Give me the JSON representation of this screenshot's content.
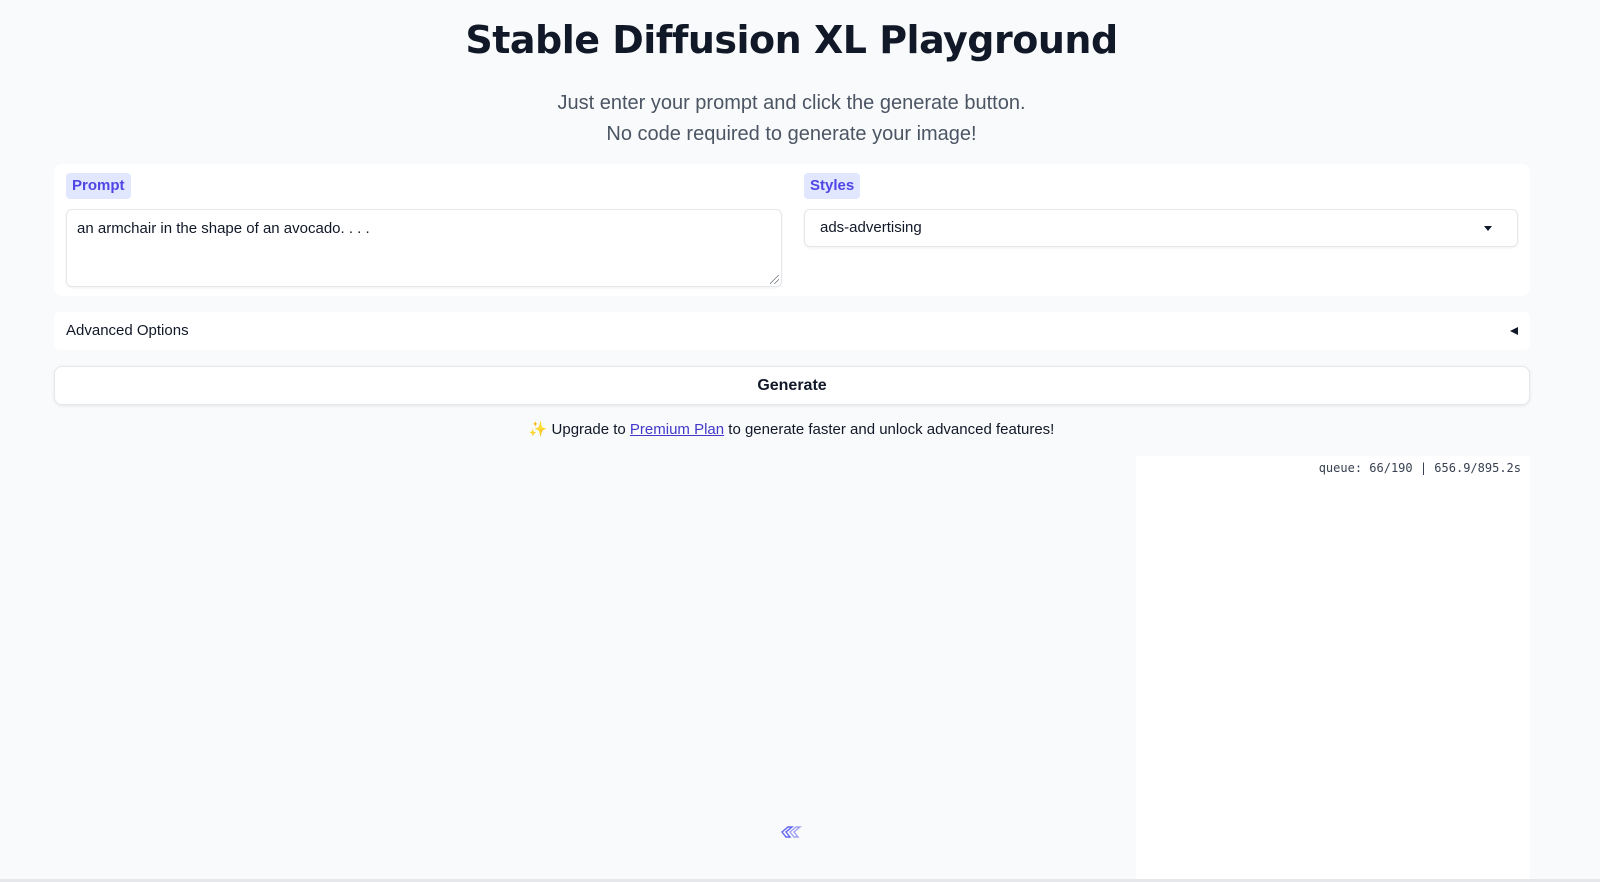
{
  "header": {
    "title": "Stable Diffusion XL Playground",
    "subtitle_line1": "Just enter your prompt and click the generate button.",
    "subtitle_line2": "No code required to generate your image!"
  },
  "prompt": {
    "label": "Prompt",
    "value": "an armchair in the shape of an avocado. . . ."
  },
  "styles": {
    "label": "Styles",
    "selected": "ads-advertising"
  },
  "advanced": {
    "label": "Advanced Options",
    "collapsed": true
  },
  "generate": {
    "label": "Generate"
  },
  "upgrade": {
    "icon": "✨",
    "prefix": "Upgrade to",
    "link_text": "Premium Plan",
    "suffix": "to generate faster and unlock advanced features!"
  },
  "output": {
    "queue_status": "queue: 66/190 | 656.9/895.2s"
  },
  "colors": {
    "accent": "#4f46e5",
    "label_bg": "#e0e7ff",
    "page_bg": "#f9fafb"
  }
}
